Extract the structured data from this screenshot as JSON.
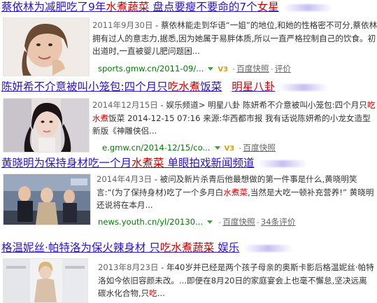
{
  "results": [
    {
      "title_prefix": "蔡依林为减肥吃了9年",
      "title_hl": "水煮蔬菜",
      "title_suffix": " 盘点要瘦不要命的7个",
      "title_hl2": "女星",
      "date": "2011年9月30日",
      "snippet": " - 蔡依林能走到华语“一姐”的地位,和她的性格密不可分,蔡依林拥有过人的意志力,据悉,因为她属于易胖体质,所以一直严格控制自己的饮食。初出道时,一直被婴儿肥问题困...",
      "url": "sports.gmw.cn/2011-09/...",
      "badge": "V3",
      "snapshot": "百度快照",
      "extra": "评价"
    },
    {
      "title_prefix": "陈妍希不介意被叫小笼包:四个月只",
      "title_hl": "吃水煮",
      "title_suffix": "饭菜",
      "title_hl2": "明星八卦",
      "date": "2014年12月15日",
      "snippet_pre": " - 娱乐频道> 明星八卦 陈妍希不介意被叫小笼包:四个月只",
      "snippet_hl": "吃水煮",
      "snippet_post": "饭菜 2014-12-15 07:16 来源:华西都市报 我有话说陈妍希的小龙女造型 新版《神雕侠侣...",
      "url": "e.gmw.cn/2014-12/15/co...",
      "badge": "V3",
      "snapshot": "百度快照"
    },
    {
      "title_prefix": "黄晓明为保持身材吃一个月",
      "title_hl": "水煮菜",
      "title_suffix": " 单眼拍戏新闻频道",
      "date": "2014年4月3日",
      "snippet_pre": " - 被问及新片杀青后他最想做的第一件事是什么,黄晓明笑言:“(为了保持身材)吃了一个多月白",
      "snippet_hl": "水煮菜",
      "snippet_post": ",当然是大吃一顿补充营养!” 黄晓明还说将在本月...",
      "url": "news.youth.cn/yl/20130...",
      "snapshot": "百度快照",
      "extra": "34条评价"
    },
    {
      "title_prefix": "格温妮丝·帕特洛为保火辣身材 只",
      "title_hl": "吃水煮蔬菜",
      "title_suffix": " 娱乐",
      "date": "2013年8月23日",
      "snippet_pre": " - 年40岁并已经是两个孩子母亲的奥斯卡影后格温妮丝·帕特洛如今依旧容颜未改。...即便在8月20日的家庭宴会上也毫不懈怠,坚决远离碳水化合物,只",
      "snippet_hl": "吃",
      "snippet_post": "..."
    }
  ]
}
